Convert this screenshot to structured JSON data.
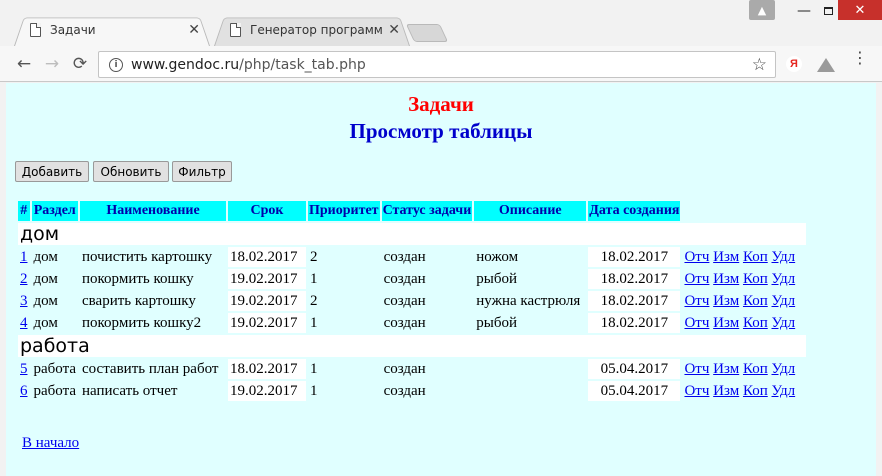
{
  "browser": {
    "tabs": [
      {
        "title": "Задачи",
        "close": "✕"
      },
      {
        "title": "Генератор программ",
        "close": "✕"
      }
    ],
    "window": {
      "minimize": "—",
      "close": "✕",
      "user": "▲"
    },
    "url_host": "www.gendoc.ru",
    "url_path": "/php/task_tab.php",
    "back": "←",
    "forward": "→",
    "reload": "⟳",
    "star": "☆",
    "info": "i",
    "yandex": "Я",
    "menu": "⋮"
  },
  "page": {
    "title": "Задачи",
    "subtitle": "Просмотр таблицы",
    "buttons": {
      "add": "Добавить",
      "refresh": "Обновить",
      "filter": "Фильтр"
    },
    "columns": [
      "#",
      "Раздел",
      "Наименование",
      "Срок",
      "Приоритет",
      "Статус задачи",
      "Описание",
      "Дата создания"
    ],
    "groups": [
      {
        "name": "дом",
        "rows": [
          {
            "num": "1",
            "section": "дом",
            "name": "почистить картошку",
            "due": "18.02.2017",
            "priority": "2",
            "status": "создан",
            "description": "ножом",
            "created": "18.02.2017"
          },
          {
            "num": "2",
            "section": "дом",
            "name": "покормить кошку",
            "due": "19.02.2017",
            "priority": "1",
            "status": "создан",
            "description": "рыбой",
            "created": "18.02.2017"
          },
          {
            "num": "3",
            "section": "дом",
            "name": "сварить картошку",
            "due": "19.02.2017",
            "priority": "2",
            "status": "создан",
            "description": "нужна кастрюля",
            "created": "18.02.2017"
          },
          {
            "num": "4",
            "section": "дом",
            "name": "покормить кошку2",
            "due": "19.02.2017",
            "priority": "1",
            "status": "создан",
            "description": "рыбой",
            "created": "18.02.2017"
          }
        ]
      },
      {
        "name": "работа",
        "rows": [
          {
            "num": "5",
            "section": "работа",
            "name": "составить план работ",
            "due": "18.02.2017",
            "priority": "1",
            "status": "создан",
            "description": "",
            "created": "05.04.2017"
          },
          {
            "num": "6",
            "section": "работа",
            "name": "написать отчет",
            "due": "19.02.2017",
            "priority": "1",
            "status": "создан",
            "description": "",
            "created": "05.04.2017"
          }
        ]
      }
    ],
    "row_actions": [
      "Отч",
      "Изм",
      "Коп",
      "Удл"
    ],
    "home_link": "В начало"
  },
  "colors": {
    "bg": "#e0ffff",
    "header_bg": "#00ffff",
    "title": "#ff0000",
    "subtitle": "#0000cc"
  }
}
